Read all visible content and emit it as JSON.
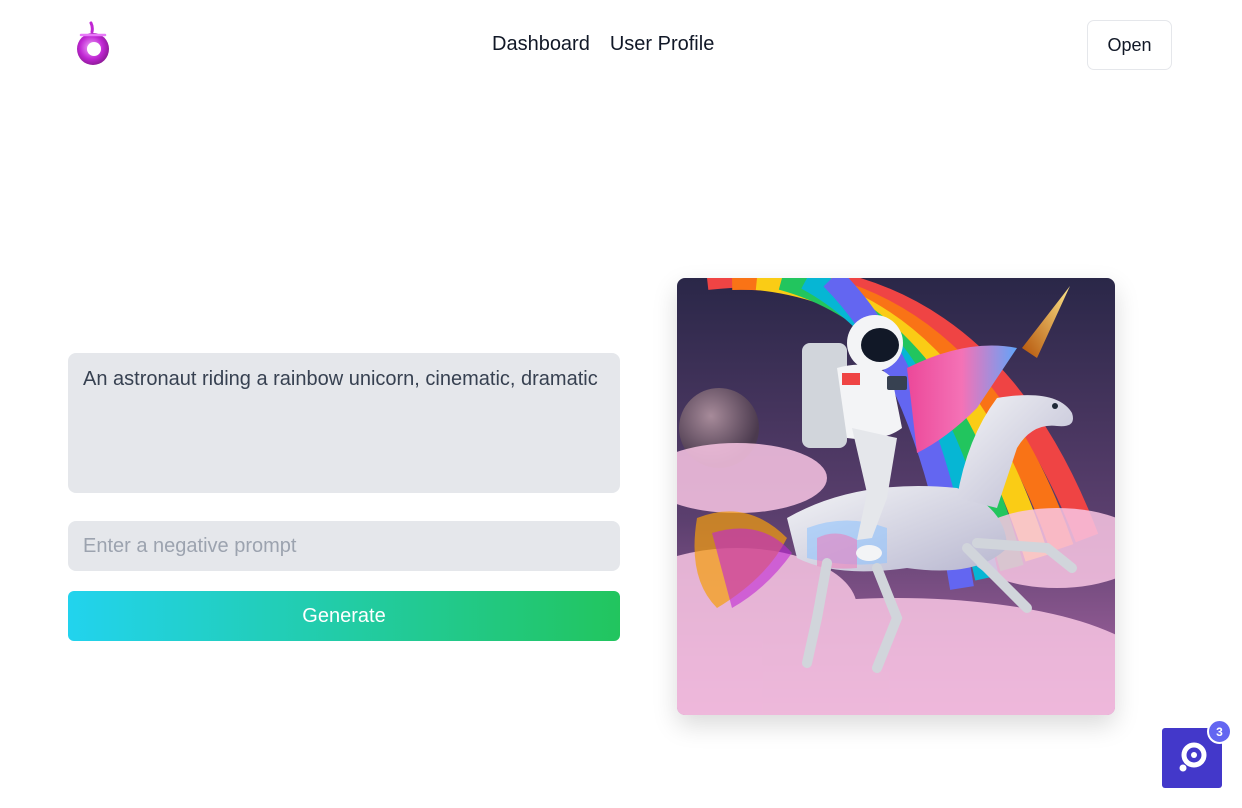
{
  "header": {
    "logo_icon": "fruit-logo-icon",
    "nav": [
      {
        "label": "Dashboard"
      },
      {
        "label": "User Profile"
      }
    ],
    "open_label": "Open"
  },
  "form": {
    "prompt_value": "An astronaut riding a rainbow unicorn, cinematic, dramatic",
    "negative_placeholder": "Enter a negative prompt",
    "generate_label": "Generate"
  },
  "result": {
    "image_icon": "generated-image"
  },
  "help": {
    "icon": "help-widget-icon",
    "badge_count": "3"
  },
  "colors": {
    "gradient_start": "#22d3ee",
    "gradient_end": "#22c55e",
    "help_bg": "#4338ca",
    "logo": "#c026d3"
  }
}
